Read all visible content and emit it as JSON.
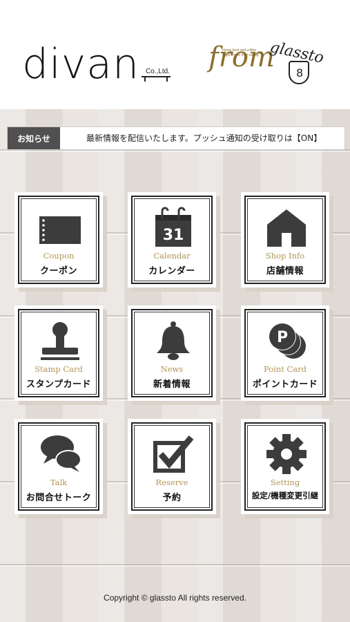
{
  "header": {
    "brand_main": "divan",
    "brand_main_suffix": "Co.,Ltd.",
    "brand_second": "from",
    "brand_second_tagline": "Home food and coffee Night inside from eating",
    "brand_third": "glassto",
    "brand_third_badge": "8"
  },
  "notice": {
    "label": "お知らせ",
    "text": "最新情報を配信いたします。プッシュ通知の受け取りは【ON】"
  },
  "menu": [
    {
      "en": "Coupon",
      "ja": "クーポン",
      "icon": "coupon-ticket-icon"
    },
    {
      "en": "Calendar",
      "ja": "カレンダー",
      "icon": "calendar-icon",
      "calendar_day": "31"
    },
    {
      "en": "Shop Info",
      "ja": "店舗情報",
      "icon": "shop-house-icon"
    },
    {
      "en": "Stamp Card",
      "ja": "スタンプカード",
      "icon": "stamp-icon"
    },
    {
      "en": "News",
      "ja": "新着情報",
      "icon": "bell-icon"
    },
    {
      "en": "Point Card",
      "ja": "ポイントカード",
      "icon": "point-coins-icon",
      "coin_letter": "P"
    },
    {
      "en": "Talk",
      "ja": "お問合せトーク",
      "icon": "chat-bubbles-icon"
    },
    {
      "en": "Reserve",
      "ja": "予約",
      "icon": "checkbox-check-icon"
    },
    {
      "en": "Setting",
      "ja": "設定/機種変更引継",
      "icon": "gear-icon"
    }
  ],
  "footer": {
    "copyright": "Copyright © glassto All rights reserved."
  },
  "colors": {
    "accent_gold": "#b29357",
    "notice_label_bg": "#505050",
    "icon_dark": "#3c3c3c"
  }
}
